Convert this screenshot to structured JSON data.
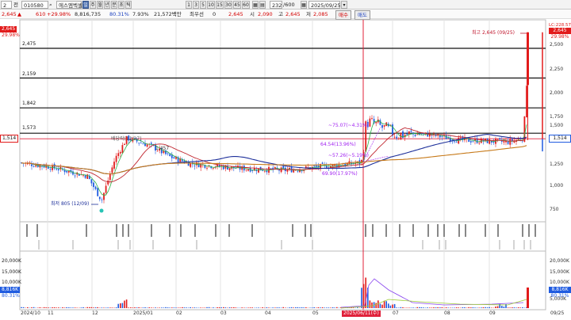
{
  "toolbar": {
    "interval_value": "2",
    "period_label": "전",
    "code_value": "010580",
    "name_value": "에스엠벡셀",
    "period_buttons": [
      "주",
      "월",
      "년",
      "분",
      "초",
      "틱"
    ],
    "minute_buttons": [
      "1",
      "3",
      "5",
      "10",
      "15",
      "30",
      "45",
      "60"
    ],
    "count_value": "232",
    "count_total": "/600",
    "date_value": "2025/09/25",
    "buy_label": "매수",
    "sell_label": "매도"
  },
  "quote": {
    "price": "2,645",
    "change": "610",
    "change_pct": "+29.98%",
    "volume": "8,816,735",
    "ratio": "80.31%",
    "turnover_pct": "7.93%",
    "amount": "21,572백만",
    "priority_label": "최우선",
    "priority_value": "0",
    "last": "2,645",
    "open_label": "시",
    "open": "2,090",
    "high_label": "고",
    "high": "2,645",
    "low_label": "저",
    "low": "2,085"
  },
  "price_axis": [
    "2,500",
    "2,250",
    "2,000",
    "1,750",
    "1,500",
    "1,250",
    "1,000",
    "750"
  ],
  "price_badges": {
    "left_top": "2,645",
    "left_top2": "29.98%",
    "left_current": "1,514",
    "right_top": "2,645",
    "right_top2": "29.98%",
    "right_current": "1,514",
    "right_corner": "LC:228.57"
  },
  "h_lines": [
    "2,475",
    "2,159",
    "1,842",
    "1,573"
  ],
  "annotations": {
    "high": "최고 2,645 (09/25)",
    "low": "최저 805 (12/09)",
    "a1": "~75.07(~4.31%)",
    "a2": "64.54(13.96%)",
    "a3": "~57.26(~5.19%)",
    "a4": "69.90(17.97%)",
    "a5": "배당락(12/27)",
    "a6": "1,457"
  },
  "volume_axis": [
    "20,000K",
    "15,000K",
    "10,000K",
    "5,000K"
  ],
  "volume_badges": {
    "left_val": "8,816K",
    "left_pct": "80.31%",
    "right_val": "8,816K",
    "right_pct": "80.31%"
  },
  "x_axis": [
    "2024/10",
    "11",
    "12",
    "2025/01",
    "02",
    "03",
    "04",
    "05",
    "07",
    "08",
    "09",
    "09/25"
  ],
  "cursor_date": "2025/06/11(수)",
  "colors": {
    "up": "#e21b1b",
    "down": "#1f5be0",
    "ma5": "#2bb24a",
    "ma20": "#c0262f",
    "ma60": "#1d2f9a",
    "ma120": "#c77a1a",
    "cursor": "#e0203a"
  },
  "chart_data": {
    "type": "line",
    "title": "",
    "x": [
      "2024/10",
      "11",
      "12",
      "2025/01",
      "02",
      "03",
      "04",
      "05",
      "06",
      "07",
      "08",
      "09",
      "09/25"
    ],
    "series": [
      {
        "values": [
          1240,
          1200,
          850,
          1420,
          1230,
          1200,
          1190,
          1210,
          1600,
          1520,
          1480,
          1510,
          2645
        ]
      }
    ],
    "ylim": [
      650,
      2650
    ],
    "high": 2645,
    "low": 805
  }
}
